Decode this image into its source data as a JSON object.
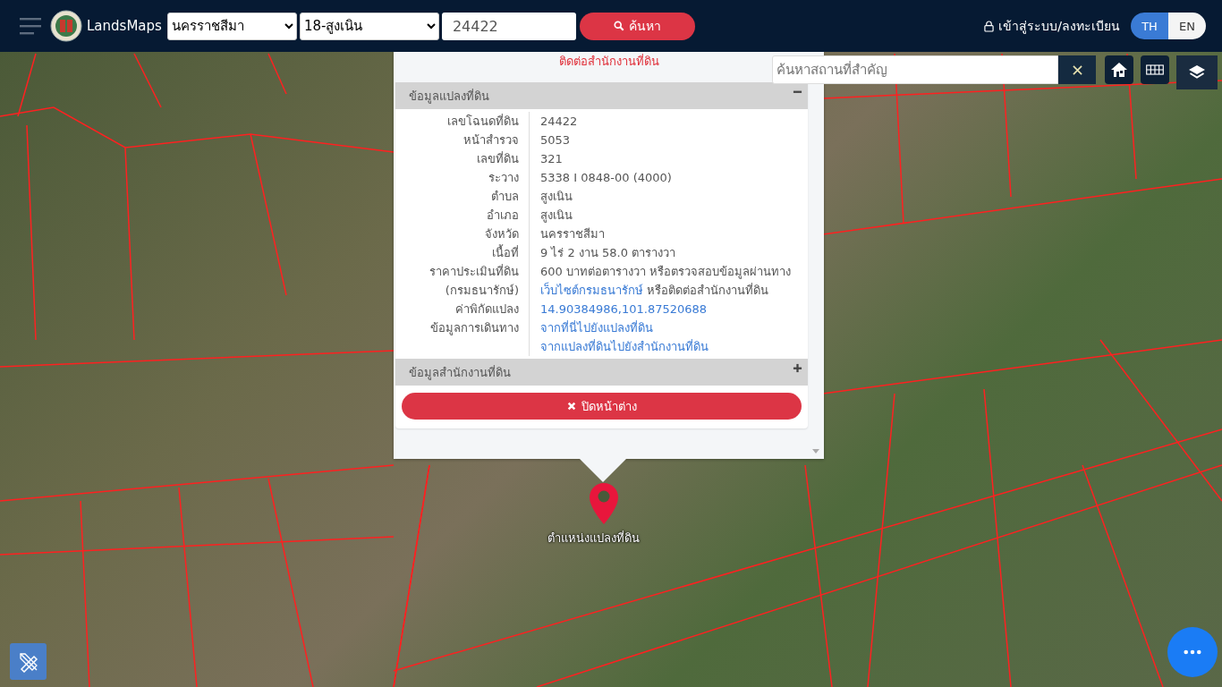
{
  "header": {
    "logo_text": "LandsMaps",
    "province": "นครราชสีมา",
    "district": "18-สูงเนิน",
    "parcel_number": "24422",
    "search_button": "ค้นหา",
    "login": "เข้าสู่ระบบ/ลงทะเบียน",
    "languages": [
      {
        "label": "TH",
        "selected": true
      },
      {
        "label": "EN",
        "selected": false
      }
    ]
  },
  "map": {
    "place_search": {
      "placeholder": "ค้นหาสถานที่สำคัญ"
    },
    "marker_label": "ตำแหน่งแปลงที่ดิน"
  },
  "popup": {
    "notice": "ติดต่อสำนักงานที่ดิน",
    "sections": [
      {
        "title": "ข้อมูลแปลงที่ดิน",
        "expanded": true,
        "rows": [
          {
            "label": "เลขโฉนดที่ดิน",
            "lines": [
              [
                {
                  "kind": "text",
                  "text": "24422"
                }
              ]
            ]
          },
          {
            "label": "หน้าสำรวจ",
            "lines": [
              [
                {
                  "kind": "text",
                  "text": "5053"
                }
              ]
            ]
          },
          {
            "label": "เลขที่ดิน",
            "lines": [
              [
                {
                  "kind": "text",
                  "text": "321"
                }
              ]
            ]
          },
          {
            "label": "ระวาง",
            "lines": [
              [
                {
                  "kind": "text",
                  "text": "5338 I 0848-00 (4000)"
                }
              ]
            ]
          },
          {
            "label": "ตำบล",
            "lines": [
              [
                {
                  "kind": "text",
                  "text": "สูงเนิน"
                }
              ]
            ]
          },
          {
            "label": "อำเภอ",
            "lines": [
              [
                {
                  "kind": "text",
                  "text": "สูงเนิน"
                }
              ]
            ]
          },
          {
            "label": "จังหวัด",
            "lines": [
              [
                {
                  "kind": "text",
                  "text": "นครราชสีมา"
                }
              ]
            ]
          },
          {
            "label": "เนื้อที่",
            "lines": [
              [
                {
                  "kind": "text",
                  "text": "9 ไร่ 2 งาน 58.0 ตารางวา"
                }
              ]
            ]
          },
          {
            "label": "ราคาประเมินที่ดิน",
            "lines": [
              [
                {
                  "kind": "text",
                  "text": "600 บาทต่อตารางวา หรือตรวจสอบข้อมูลผ่านทาง"
                }
              ]
            ]
          },
          {
            "label": "(กรมธนารักษ์)",
            "lines": [
              [
                {
                  "kind": "link",
                  "text": "เว็บไซต์กรมธนารักษ์"
                },
                {
                  "kind": "text",
                  "text": " หรือติดต่อสำนักงานที่ดิน"
                }
              ]
            ]
          },
          {
            "label": "ค่าพิกัดแปลง",
            "lines": [
              [
                {
                  "kind": "link",
                  "text": "14.90384986,101.87520688"
                }
              ]
            ]
          },
          {
            "label": "ข้อมูลการเดินทาง",
            "lines": [
              [
                {
                  "kind": "link",
                  "text": "จากที่นี่ไปยังแปลงที่ดิน"
                }
              ],
              [
                {
                  "kind": "link",
                  "text": "จากแปลงที่ดินไปยังสำนักงานที่ดิน"
                }
              ]
            ]
          }
        ]
      },
      {
        "title": "ข้อมูลสำนักงานที่ดิน",
        "expanded": false
      }
    ],
    "close_button": "ปิดหน้าต่าง"
  }
}
